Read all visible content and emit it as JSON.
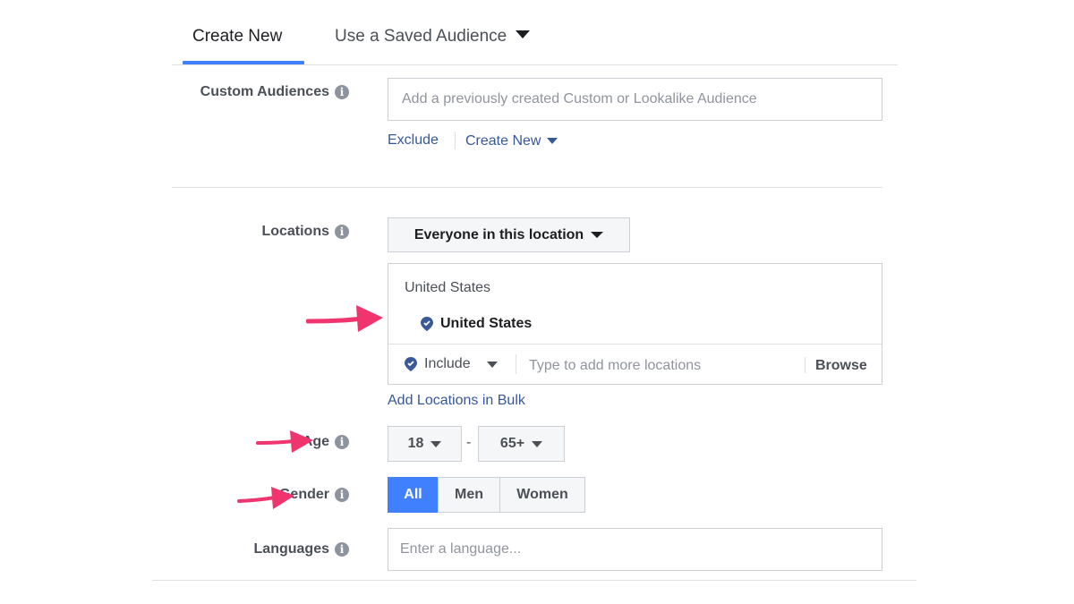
{
  "tabs": {
    "create_new": "Create New",
    "saved_audience": "Use a Saved Audience"
  },
  "custom_audiences": {
    "label": "Custom Audiences",
    "placeholder": "Add a previously created Custom or Lookalike Audience",
    "exclude": "Exclude",
    "create_new": "Create New"
  },
  "locations": {
    "label": "Locations",
    "dropdown": "Everyone in this location",
    "group_title": "United States",
    "selected": "United States",
    "include": "Include",
    "placeholder": "Type to add more locations",
    "browse": "Browse",
    "bulk_link": "Add Locations in Bulk"
  },
  "age": {
    "label": "Age",
    "min": "18",
    "separator": "-",
    "max": "65+"
  },
  "gender": {
    "label": "Gender",
    "options": [
      "All",
      "Men",
      "Women"
    ],
    "selected": "All"
  },
  "languages": {
    "label": "Languages",
    "placeholder": "Enter a language..."
  },
  "colors": {
    "accent": "#4080ff",
    "link": "#365899",
    "annotation_arrow": "#f0346e"
  }
}
